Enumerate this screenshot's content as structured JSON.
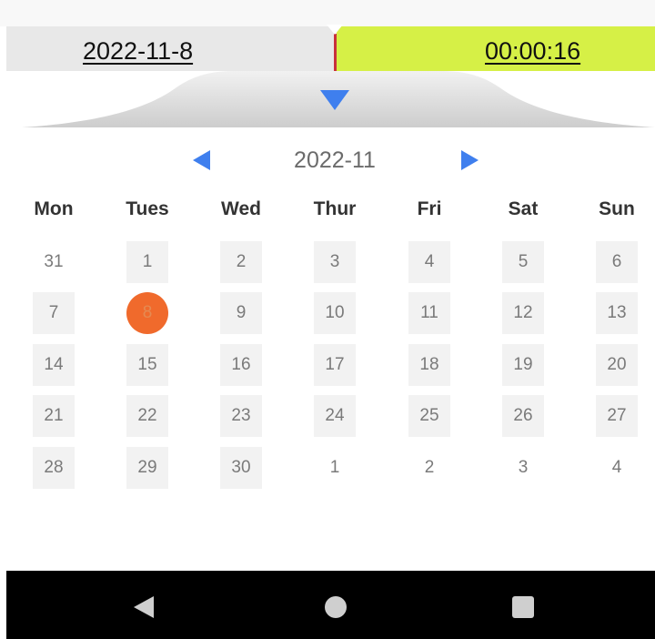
{
  "timeline": {
    "date": "2022-11-8",
    "time": "00:00:16"
  },
  "calendar": {
    "month_label": "2022-11",
    "weekdays": [
      "Mon",
      "Tues",
      "Wed",
      "Thur",
      "Fri",
      "Sat",
      "Sun"
    ],
    "weeks": [
      [
        "31",
        "1",
        "2",
        "3",
        "4",
        "5",
        "6"
      ],
      [
        "7",
        "8",
        "9",
        "10",
        "11",
        "12",
        "13"
      ],
      [
        "14",
        "15",
        "16",
        "17",
        "18",
        "19",
        "20"
      ],
      [
        "21",
        "22",
        "23",
        "24",
        "25",
        "26",
        "27"
      ],
      [
        "28",
        "29",
        "30",
        "1",
        "2",
        "3",
        "4"
      ]
    ],
    "selected_day": "8"
  },
  "colors": {
    "accent_blue": "#3f7fee",
    "selected_orange": "#f06a2c",
    "timeline_green": "#d6f046",
    "cursor_red": "#c8323c"
  },
  "icons": {
    "collapse": "triangle-down-icon",
    "prev_month": "triangle-left-icon",
    "next_month": "triangle-right-icon",
    "back": "nav-back-icon",
    "home": "nav-home-icon",
    "recents": "nav-recents-icon"
  }
}
